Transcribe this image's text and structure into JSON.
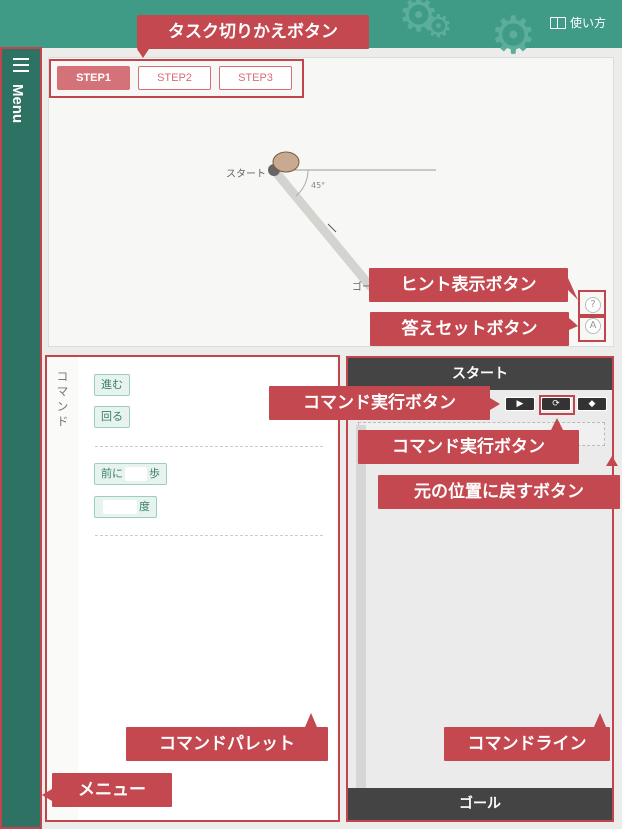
{
  "header": {
    "help_label": "使い方"
  },
  "sidebar": {
    "menu_label": "Menu"
  },
  "steps": [
    "STEP1",
    "STEP2",
    "STEP3"
  ],
  "stage": {
    "start_label": "スタート",
    "goal_label": "ゴール",
    "angle_label": "45°"
  },
  "stage_buttons": {
    "hint": "?",
    "answer": "A"
  },
  "palette": {
    "title": "コマンド",
    "commands": {
      "forward": "進む",
      "turn": "回る",
      "forward_n_prefix": "前に",
      "forward_n_suffix": "歩",
      "turn_n_suffix": "度"
    }
  },
  "command_line": {
    "start": "スタート",
    "goal": "ゴール"
  },
  "annotations": {
    "task_switch": "タスク切りかえボタン",
    "hint": "ヒント表示ボタン",
    "answer_set": "答えセットボタン",
    "run_1": "コマンド実行ボタン",
    "run_2": "コマンド実行ボタン",
    "reset": "元の位置に戻すボタン",
    "palette": "コマンドパレット",
    "line": "コマンドライン",
    "menu": "メニュー"
  },
  "colors": {
    "header": "#3f9b86",
    "sidebar": "#2d7262",
    "annotation": "#c3484f",
    "step_active": "#d4727a"
  }
}
